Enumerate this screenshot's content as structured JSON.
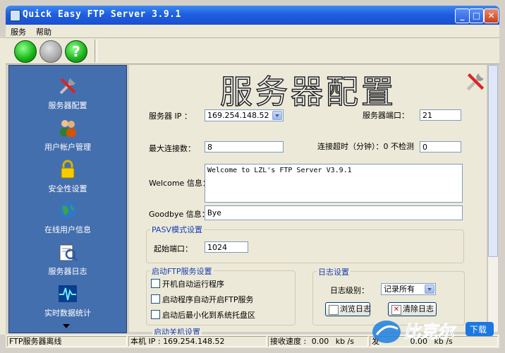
{
  "window": {
    "title": "Quick Easy FTP Server 3.9.1"
  },
  "menu": {
    "items": [
      "服务",
      "帮助"
    ]
  },
  "toolbar": {
    "help_glyph": "?"
  },
  "sidebar": {
    "items": [
      {
        "label": "服务器配置",
        "icon": "tools-icon"
      },
      {
        "label": "用户帐户管理",
        "icon": "users-icon"
      },
      {
        "label": "安全性设置",
        "icon": "lock-icon"
      },
      {
        "label": "在线用户信息",
        "icon": "globe-icon"
      },
      {
        "label": "服务器日志",
        "icon": "log-icon"
      },
      {
        "label": "实时数据统计",
        "icon": "pulse-icon"
      }
    ]
  },
  "main": {
    "heading": "服务器配置",
    "server_ip_label": "服务器 IP ：",
    "server_ip_value": "169.254.148.52",
    "server_port_label": "服务器端口：",
    "server_port_value": "21",
    "max_conn_label": "最大连接数：",
    "max_conn_value": "8",
    "timeout_label": "连接超时（分钟）：0 不检测",
    "timeout_value": "0",
    "welcome_label": "Welcome 信息：",
    "welcome_value": "Welcome to LZL's FTP Server V3.9.1",
    "goodbye_label": "Goodbye 信息：",
    "goodbye_value": "Bye",
    "pasv_group_title": "PASV模式设置",
    "pasv_start_label": "起始端口：",
    "pasv_start_value": "1024",
    "startup_group_title": "启动FTP服务设置",
    "startup_options": [
      "开机自动运行程序",
      "启动程序自动开启FTP服务",
      "启动后最小化到系统托盘区"
    ],
    "log_group_title": "日志设置",
    "log_level_label": "日志级别：",
    "log_level_value": "记录所有",
    "browse_log_button": "浏览日志",
    "clear_log_button": "清除日志",
    "close_group_title": "启动关机设置"
  },
  "status": {
    "server_state": "FTP服务器离线",
    "local_ip": "本机 IP : 169.254.148.52",
    "recv_label": "接收速度 :",
    "recv_value": "0.00",
    "recv_unit": "kb /s",
    "send_label": "发",
    "send_value": "0.00",
    "send_unit": "kb /s"
  },
  "watermark": {
    "text": "比克尔",
    "badge": "下载"
  },
  "colors": {
    "sidebar": "#446fae",
    "titlebar": "#1f5fe0",
    "group_title": "#1a3fb3"
  }
}
